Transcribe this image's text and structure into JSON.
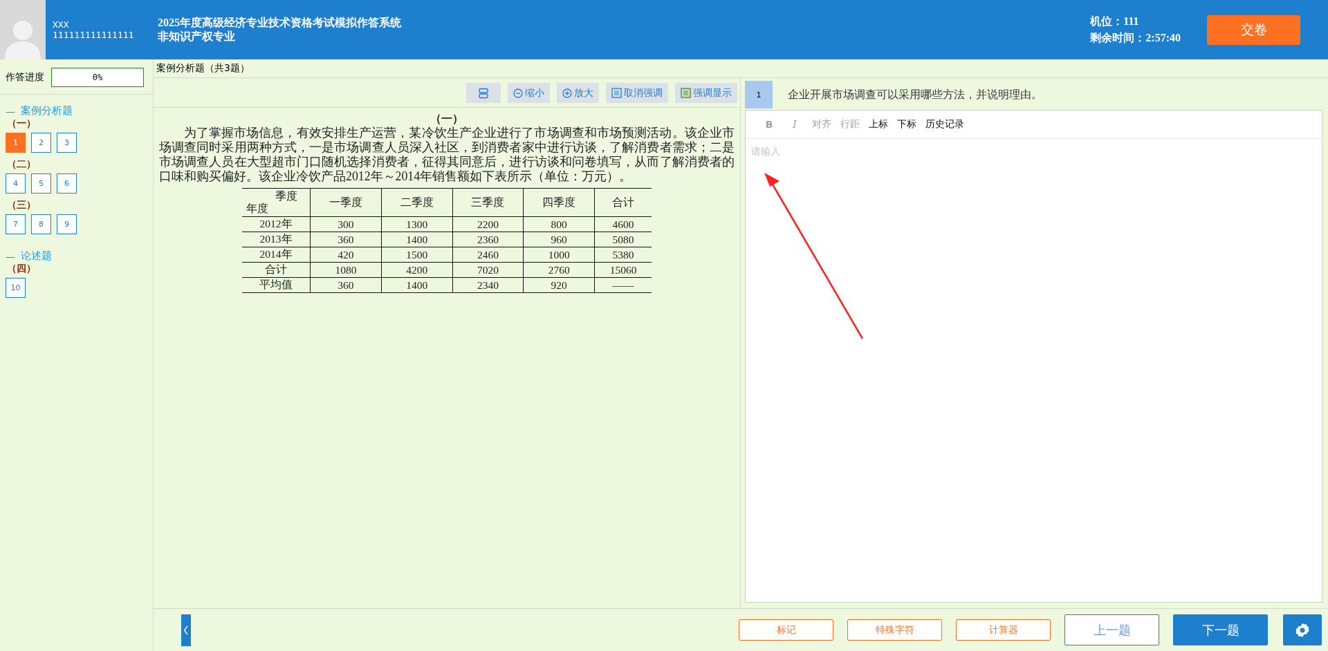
{
  "header": {
    "candidate_name": "XXX",
    "candidate_id": "111111111111111",
    "title": "2025年度高级经济专业技术资格考试模拟作答系统",
    "subtitle": "非知识产权专业",
    "seat": "机位：111",
    "time_left": "剩余时间：2:57:40",
    "submit": "交卷"
  },
  "sidebar": {
    "progress_label": "作答进度",
    "progress": {
      "level": 0,
      "text": "0%"
    },
    "groups": [
      {
        "toggle": "—",
        "title": "案例分析题",
        "expanded": true,
        "sections": [
          {
            "label": "（一）",
            "questions": [
              {
                "number": "1",
                "selected": true
              },
              {
                "number": "2",
                "selected": false
              },
              {
                "number": "3",
                "selected": false
              }
            ]
          },
          {
            "label": "（二）",
            "questions": [
              {
                "number": "4",
                "selected": false
              },
              {
                "number": "5",
                "selected": false
              },
              {
                "number": "6",
                "selected": false
              }
            ]
          },
          {
            "label": "（三）",
            "questions": [
              {
                "number": "7",
                "selected": false
              },
              {
                "number": "8",
                "selected": false
              },
              {
                "number": "9",
                "selected": false
              }
            ]
          }
        ]
      },
      {
        "toggle": "—",
        "title": "论述题",
        "expanded": true,
        "sections": [
          {
            "label": "（四）",
            "questions": [
              {
                "number": "10",
                "selected": false
              }
            ]
          }
        ]
      }
    ]
  },
  "section_title": "案例分析题（共3题）",
  "passage_toolbar": [
    {
      "kind": "layout"
    },
    {
      "kind": "zoom-out",
      "label": "缩小"
    },
    {
      "kind": "zoom-in",
      "label": "放大"
    },
    {
      "kind": "unhighlight",
      "label": "取消强调"
    },
    {
      "kind": "highlight",
      "label": "强调显示"
    }
  ],
  "passage": {
    "heading": "（一）",
    "text": "为了掌握市场信息，有效安排生产运营，某冷饮生产企业进行了市场调查和市场预测活动。该企业市场调查同时采用两种方式，一是市场调查人员深入社区，到消费者家中进行访谈，了解消费者需求；二是市场调查人员在大型超市门口随机选择消费者，征得其同意后，进行访谈和问卷填写，从而了解消费者的口味和购买偏好。该企业冷饮产品2012年～2014年销售额如下表所示（单位：万元）。",
    "table": {
      "row_header_label": "年度",
      "columns": [
        "季度",
        "一季度",
        "二季度",
        "三季度",
        "四季度",
        "合计"
      ],
      "rows": [
        [
          "2012年",
          "300",
          "1300",
          "2200",
          "800",
          "4600"
        ],
        [
          "2013年",
          "360",
          "1400",
          "2360",
          "960",
          "5080"
        ],
        [
          "2014年",
          "420",
          "1500",
          "2460",
          "1000",
          "5380"
        ],
        [
          "合计",
          "1080",
          "4200",
          "7020",
          "2760",
          "15060"
        ],
        [
          "平均值",
          "360",
          "1400",
          "2340",
          "920",
          "——"
        ]
      ]
    }
  },
  "question": {
    "number": "1",
    "text": "企业开展市场调查可以采用哪些方法，并说明理由。"
  },
  "editor": {
    "toolbar": [
      {
        "kind": "bold",
        "label": "B",
        "disabled": true
      },
      {
        "kind": "italic",
        "label": "I",
        "disabled": true
      },
      {
        "kind": "text",
        "label": "对齐",
        "disabled": true
      },
      {
        "kind": "text",
        "label": "行距",
        "disabled": true
      },
      {
        "kind": "text",
        "label": "上标",
        "disabled": false
      },
      {
        "kind": "text",
        "label": "下标",
        "disabled": false
      },
      {
        "kind": "text",
        "label": "历史记录",
        "disabled": false
      }
    ],
    "placeholder": "请输入"
  },
  "footer": {
    "buttons": [
      {
        "kind": "tool",
        "label": "标记"
      },
      {
        "kind": "tool",
        "label": "特殊字符"
      },
      {
        "kind": "tool",
        "label": "计算器"
      },
      {
        "kind": "secondary",
        "label": "上一题"
      },
      {
        "kind": "primary",
        "label": "下一题"
      }
    ]
  }
}
